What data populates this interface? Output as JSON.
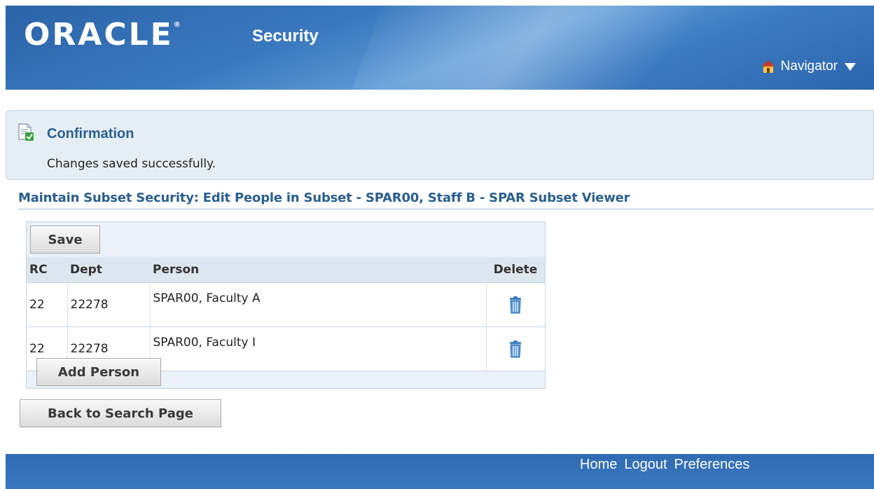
{
  "header": {
    "logo_text": "ORACLE",
    "logo_mark": "®",
    "app_title": "Security",
    "navigator_label": "Navigator",
    "home_icon": "home-icon",
    "colors": {
      "header_blue": "#2b63a8",
      "footer_blue": "#2f6bb3"
    }
  },
  "confirmation": {
    "title": "Confirmation",
    "message": "Changes saved successfully.",
    "icon": "confirmation-document-check-icon"
  },
  "page": {
    "title": "Maintain Subset Security: Edit People in Subset - SPAR00, Staff B - SPAR Subset Viewer"
  },
  "table": {
    "save_label": "Save",
    "columns": [
      "RC",
      "Dept",
      "Person",
      "Delete"
    ],
    "rows": [
      {
        "rc": "22",
        "dept": "22278",
        "person": "SPAR00, Faculty A"
      },
      {
        "rc": "22",
        "dept": "22278",
        "person": "SPAR00, Faculty I"
      }
    ],
    "delete_icon": "trash-icon",
    "add_label": "Add Person"
  },
  "actions": {
    "back_label": "Back to Search Page"
  },
  "footer": {
    "links": [
      "Home",
      "Logout",
      "Preferences"
    ]
  }
}
